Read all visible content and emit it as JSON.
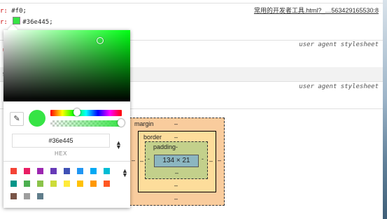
{
  "styles": {
    "line1_prop": "r: ",
    "line1_value": "#f0;",
    "line2_prop": "r: ",
    "line2_value": "#36e445;",
    "source_link": "常用的开发者工具.html?_…563429165530:8",
    "ua_label_1": "user agent stylesheet",
    "ua_label_2": "user agent stylesheet",
    "stub1": "u",
    "stub2": "f",
    "colors": {
      "swatch": "#36e445",
      "prop_name": "#c80000"
    }
  },
  "box_model": {
    "margin_label": "margin",
    "margin_top": "–",
    "margin_bottom": "–",
    "margin_left": "–",
    "margin_right": "–",
    "border_label": "border",
    "border_top": "–",
    "border_bottom": "–",
    "border_left": "–",
    "border_right": "–",
    "padding_label": "padding-",
    "padding_bottom": "–",
    "padding_left": "-",
    "padding_right": "-",
    "content_size": "134 × 21",
    "colors": {
      "margin": "#f9cc9d",
      "border": "#fddd9b",
      "padding": "#c3d08b",
      "content": "#8cb6c0"
    }
  },
  "color_picker": {
    "hex_value": "#36e445",
    "format_label": "HEX",
    "current_color": "#36e445",
    "hue_level": 0.37,
    "alpha_level": 1.0,
    "eyedropper_icon": "eyedropper-icon",
    "format_toggle_icon": "up-down-arrows-icon",
    "palette_toggle_icon": "up-down-arrows-icon",
    "palette": [
      "#f44336",
      "#e91e63",
      "#9c27b0",
      "#673ab7",
      "#3f51b5",
      "#2196f3",
      "#03a9f4",
      "#00bcd4",
      "#009688",
      "#4caf50",
      "#8bc34a",
      "#cddc39",
      "#ffeb3b",
      "#ffc107",
      "#ff9800",
      "#ff5722",
      "#795548",
      "#9e9e9e",
      "#607d8b"
    ]
  }
}
